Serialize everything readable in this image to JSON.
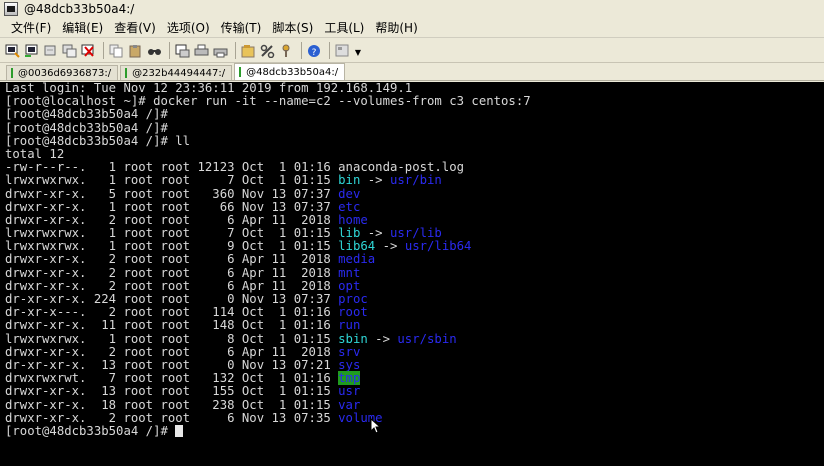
{
  "window": {
    "title": "@48dcb33b50a4:/"
  },
  "menu": [
    "文件(F)",
    "编辑(E)",
    "查看(V)",
    "选项(O)",
    "传输(T)",
    "脚本(S)",
    "工具(L)",
    "帮助(H)"
  ],
  "toolbar": {
    "buttons": [
      "new-session-icon",
      "open-icon",
      "reconnect-icon",
      "clone-icon",
      "disconnect-icon",
      "copy-icon",
      "paste-icon",
      "find-icon",
      "print-setup-icon",
      "print-icon",
      "print-screen-icon",
      "session-options-icon",
      "global-options-icon",
      "key-icon",
      "help-icon",
      "layout-icon"
    ]
  },
  "tabs": [
    {
      "label": "@0036d6936873:/",
      "active": false
    },
    {
      "label": "@232b44494447:/",
      "active": false
    },
    {
      "label": "@48dcb33b50a4:/",
      "active": true
    }
  ],
  "terminal": {
    "header": [
      "Last login: Tue Nov 12 23:36:11 2019 from 192.168.149.1",
      "[root@localhost ~]# docker run -it --name=c2 --volumes-from c3 centos:7",
      "[root@48dcb33b50a4 /]#",
      "[root@48dcb33b50a4 /]#",
      "[root@48dcb33b50a4 /]# ll",
      "total 12"
    ],
    "entries": [
      {
        "info": "-rw-r--r--.   1 root root 12123 Oct  1 01:16 ",
        "name": "anaconda-post.log",
        "kind": "file"
      },
      {
        "info": "lrwxrwxrwx.   1 root root     7 Oct  1 01:15 ",
        "name": "bin",
        "kind": "link",
        "target": "usr/bin"
      },
      {
        "info": "drwxr-xr-x.   5 root root   360 Nov 13 07:37 ",
        "name": "dev",
        "kind": "dir"
      },
      {
        "info": "drwxr-xr-x.   1 root root    66 Nov 13 07:37 ",
        "name": "etc",
        "kind": "dir"
      },
      {
        "info": "drwxr-xr-x.   2 root root     6 Apr 11  2018 ",
        "name": "home",
        "kind": "dir"
      },
      {
        "info": "lrwxrwxrwx.   1 root root     7 Oct  1 01:15 ",
        "name": "lib",
        "kind": "link",
        "target": "usr/lib"
      },
      {
        "info": "lrwxrwxrwx.   1 root root     9 Oct  1 01:15 ",
        "name": "lib64",
        "kind": "link",
        "target": "usr/lib64"
      },
      {
        "info": "drwxr-xr-x.   2 root root     6 Apr 11  2018 ",
        "name": "media",
        "kind": "dir"
      },
      {
        "info": "drwxr-xr-x.   2 root root     6 Apr 11  2018 ",
        "name": "mnt",
        "kind": "dir"
      },
      {
        "info": "drwxr-xr-x.   2 root root     6 Apr 11  2018 ",
        "name": "opt",
        "kind": "dir"
      },
      {
        "info": "dr-xr-xr-x. 224 root root     0 Nov 13 07:37 ",
        "name": "proc",
        "kind": "dir"
      },
      {
        "info": "dr-xr-x---.   2 root root   114 Oct  1 01:16 ",
        "name": "root",
        "kind": "dir"
      },
      {
        "info": "drwxr-xr-x.  11 root root   148 Oct  1 01:16 ",
        "name": "run",
        "kind": "dir"
      },
      {
        "info": "lrwxrwxrwx.   1 root root     8 Oct  1 01:15 ",
        "name": "sbin",
        "kind": "link",
        "target": "usr/sbin"
      },
      {
        "info": "drwxr-xr-x.   2 root root     6 Apr 11  2018 ",
        "name": "srv",
        "kind": "dir"
      },
      {
        "info": "dr-xr-xr-x.  13 root root     0 Nov 13 07:21 ",
        "name": "sys",
        "kind": "dir"
      },
      {
        "info": "drwxrwxrwt.   7 root root   132 Oct  1 01:16 ",
        "name": "tmp",
        "kind": "sticky"
      },
      {
        "info": "drwxr-xr-x.  13 root root   155 Oct  1 01:15 ",
        "name": "usr",
        "kind": "dir"
      },
      {
        "info": "drwxr-xr-x.  18 root root   238 Oct  1 01:15 ",
        "name": "var",
        "kind": "dir"
      },
      {
        "info": "drwxr-xr-x.   2 root root     6 Nov 13 07:35 ",
        "name": "volume",
        "kind": "dir"
      }
    ],
    "prompt": "[root@48dcb33b50a4 /]# ",
    "link_arrow": " -> "
  },
  "colors": {
    "background": "#000000",
    "text": "#d8d8d8",
    "directory": "#2a2af0",
    "symlink": "#2fd6d6",
    "sticky_bg": "#1f9c1f"
  }
}
